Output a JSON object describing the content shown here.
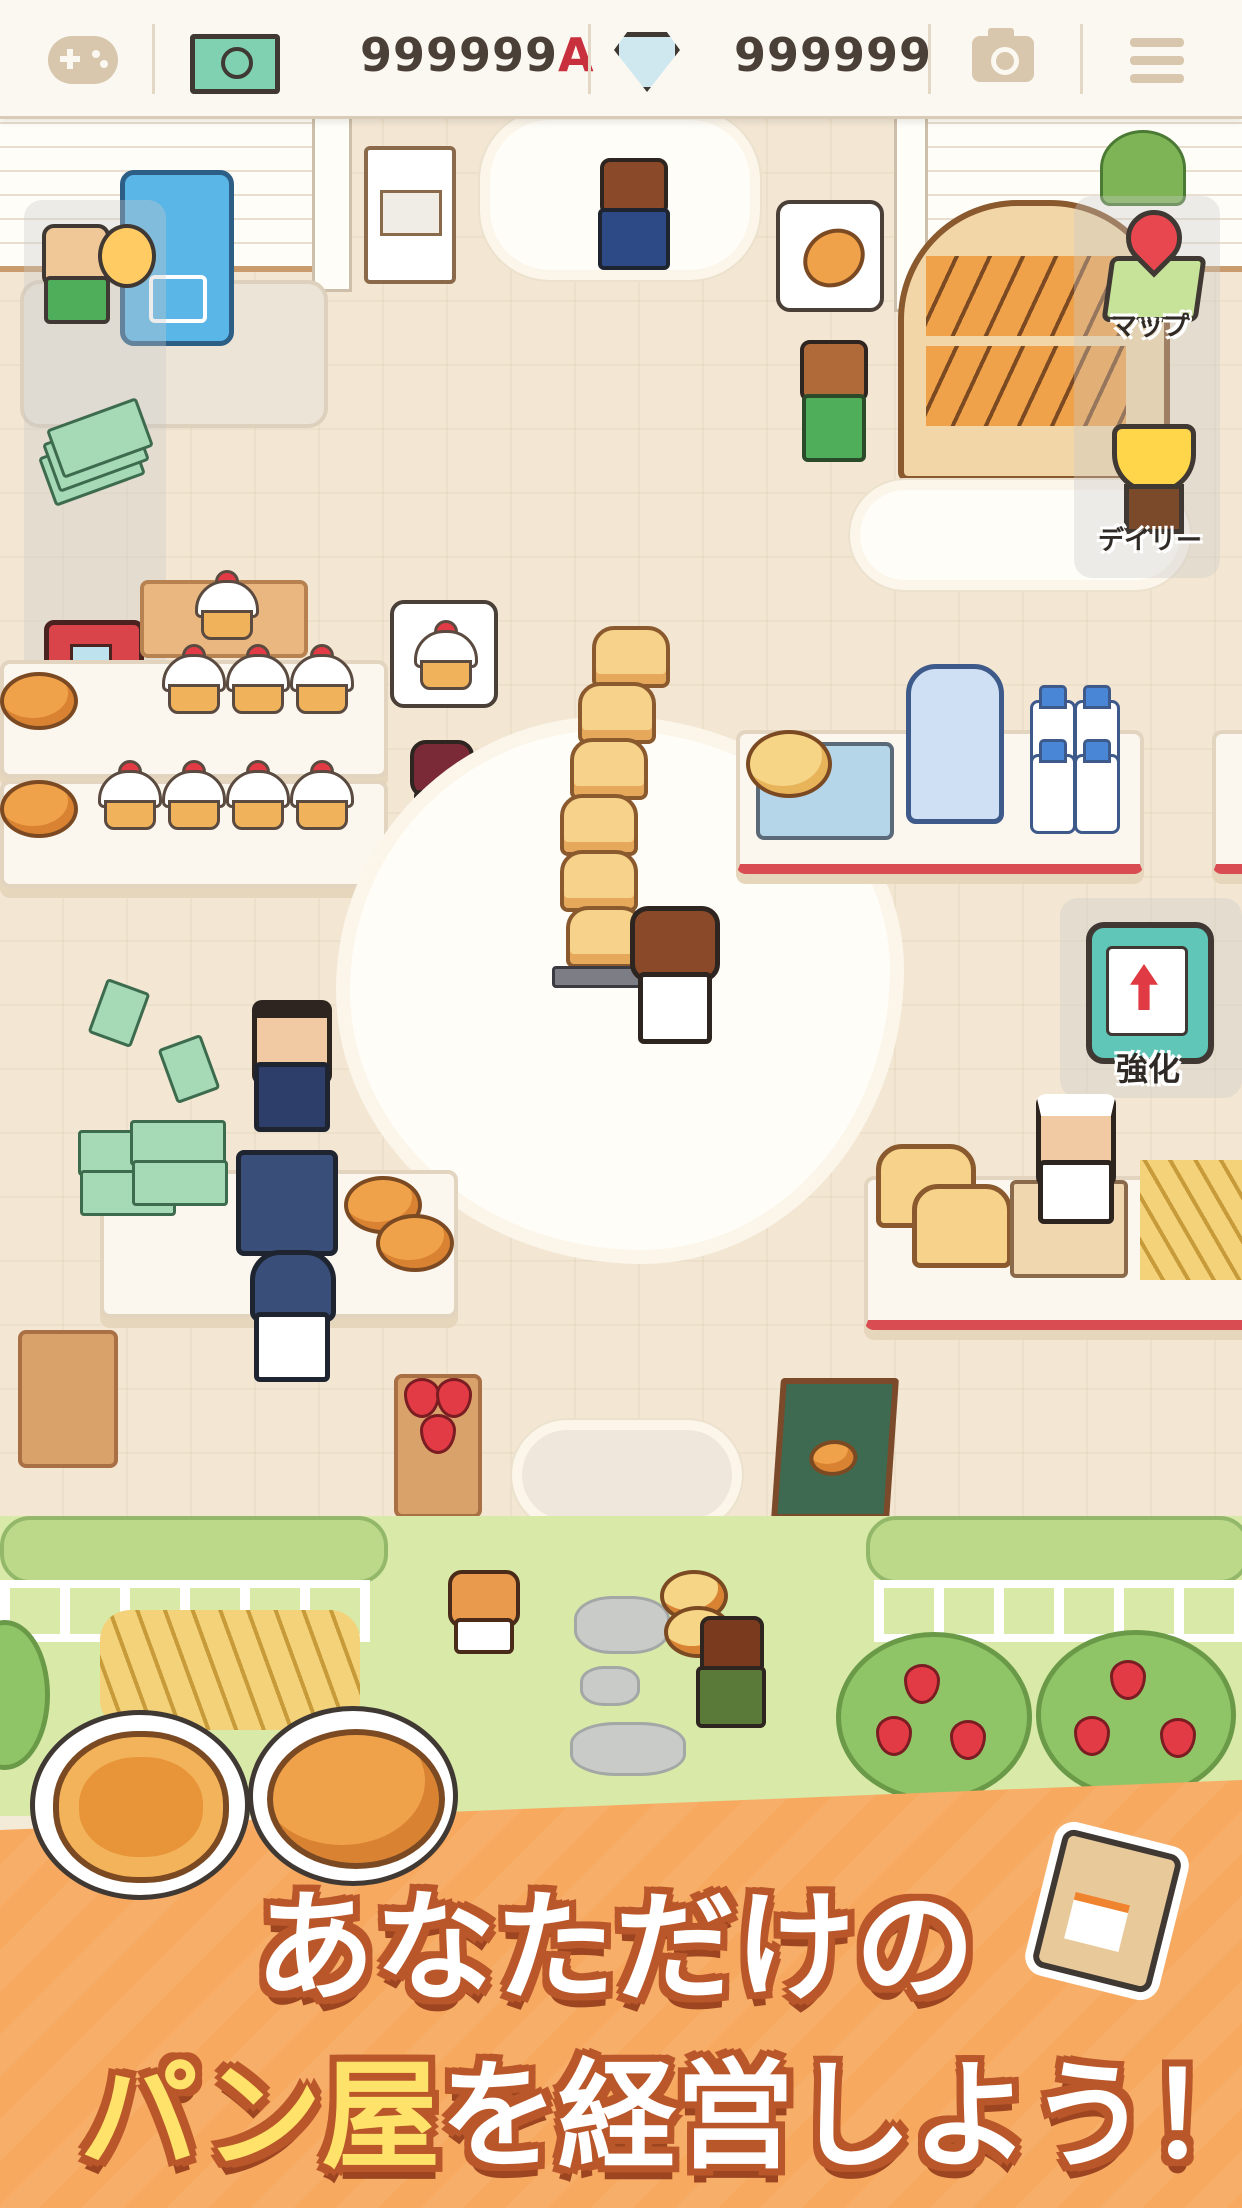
{
  "hud": {
    "cash_value": "999999",
    "cash_suffix": "A",
    "gem_value": "999999",
    "icons": [
      "gamepad-icon",
      "cash-icon",
      "diamond-icon",
      "camera-icon",
      "menu-icon"
    ]
  },
  "side_buttons": {
    "map_label": "マップ",
    "daily_label": "デイリー",
    "upgrade_label": "強化"
  },
  "banner": {
    "line1": "あなただけの",
    "line2_highlight": "パン屋",
    "line2_rest": "を経営しよう！"
  },
  "colors": {
    "banner_orange": "#f7a960",
    "text_outline": "#b9572a",
    "highlight_yellow": "#ffe26a",
    "suffix_red": "#c9303d",
    "hud_background": "#fbf8f2"
  }
}
